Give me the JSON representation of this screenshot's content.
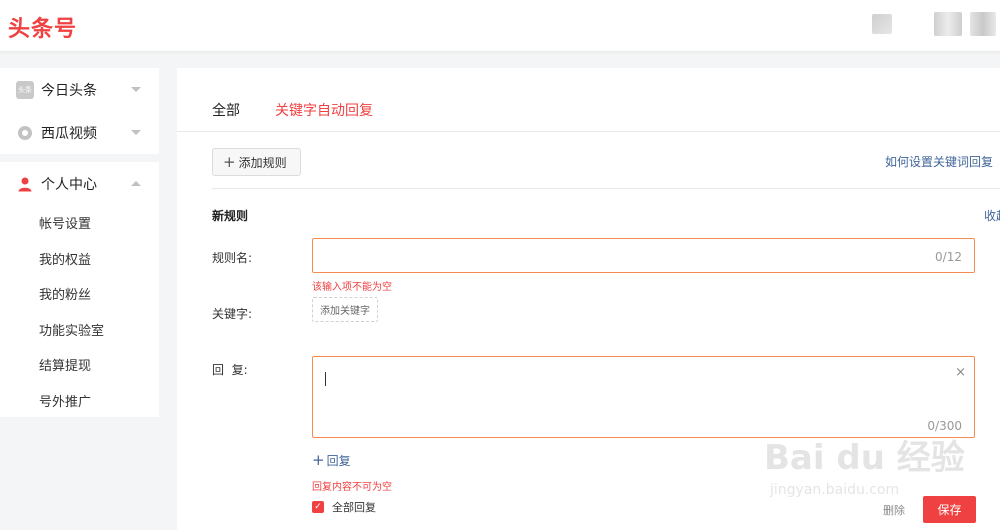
{
  "header": {
    "logo": "头条号"
  },
  "sidebar": {
    "top_items": [
      {
        "label": "今日头条",
        "icon": "toutiao-icon",
        "icon_text": "头条"
      },
      {
        "label": "西瓜视频",
        "icon": "xigua-icon"
      }
    ],
    "personal": {
      "label": "个人中心",
      "icon": "user-icon",
      "items": [
        "帐号设置",
        "我的权益",
        "我的粉丝",
        "功能实验室",
        "结算提现",
        "号外推广"
      ]
    }
  },
  "main": {
    "tabs": [
      "全部",
      "关键字自动回复"
    ],
    "add_rule": "添加规则",
    "help_link": "如何设置关键词回复",
    "new_rule_title": "新规则",
    "collapse": "收起",
    "form": {
      "rule_name_label": "规则名:",
      "rule_name_count": "0/12",
      "rule_name_error": "该输入项不能为空",
      "keyword_label": "关键字:",
      "keyword_button": "添加关键字",
      "reply_label": "回  复:",
      "reply_count": "0/300",
      "add_reply": "回复",
      "reply_error": "回复内容不可为空",
      "all_reply": "全部回复",
      "delete": "删除",
      "save": "保存"
    }
  },
  "watermark": {
    "main": "Bai du 经验",
    "sub": "jingyan.baidu.com"
  },
  "colors": {
    "accent": "#f04142",
    "link": "#406599",
    "input_border": "#f38b52"
  }
}
